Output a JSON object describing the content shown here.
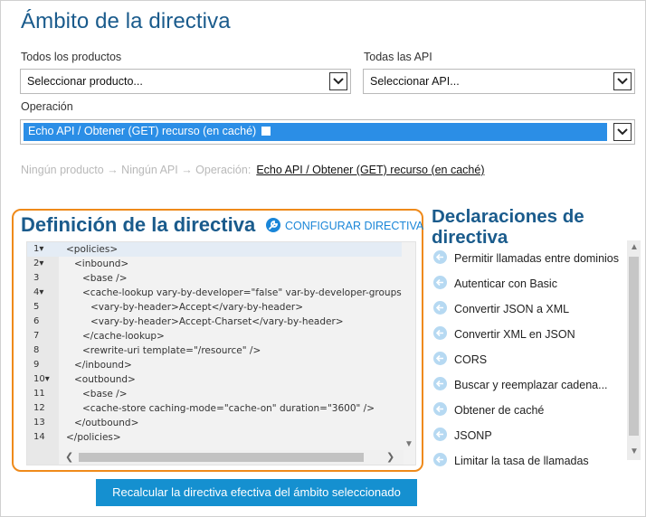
{
  "scope": {
    "title": "Ámbito de la directiva",
    "products_label": "Todos los productos",
    "products_value": "Seleccionar producto...",
    "apis_label": "Todas las API",
    "apis_value": "Seleccionar API...",
    "operation_label": "Operación",
    "operation_value": "Echo API / Obtener (GET) recurso (en caché)"
  },
  "breadcrumb": {
    "muted": "Ningún producto → Ningún API → Operación:",
    "current": "Echo API / Obtener (GET) recurso (en caché)"
  },
  "definition": {
    "title": "Definición de la directiva",
    "configure_label": "CONFIGURAR DIRECTIVA",
    "lines": [
      {
        "n": "1▾",
        "text": "<policies>",
        "indent": 0
      },
      {
        "n": "2▾",
        "text": "<inbound>",
        "indent": 1
      },
      {
        "n": "3",
        "text": "<base />",
        "indent": 2
      },
      {
        "n": "4▾",
        "text": "<cache-lookup vary-by-developer=\"false\" var-by-developer-groups=...",
        "indent": 2
      },
      {
        "n": "5",
        "text": "<vary-by-header>Accept</vary-by-header>",
        "indent": 3
      },
      {
        "n": "6",
        "text": "<vary-by-header>Accept-Charset</vary-by-header>",
        "indent": 3
      },
      {
        "n": "7",
        "text": "</cache-lookup>",
        "indent": 2
      },
      {
        "n": "8",
        "text": "<rewrite-uri template=\"/resource\" />",
        "indent": 2
      },
      {
        "n": "9",
        "text": "</inbound>",
        "indent": 1
      },
      {
        "n": "10▾",
        "text": "<outbound>",
        "indent": 1
      },
      {
        "n": "11",
        "text": "<base />",
        "indent": 2
      },
      {
        "n": "12",
        "text": "<cache-store caching-mode=\"cache-on\" duration=\"3600\" />",
        "indent": 2
      },
      {
        "n": "13",
        "text": "</outbound>",
        "indent": 1
      },
      {
        "n": "14",
        "text": "</policies>",
        "indent": 0
      }
    ]
  },
  "declarations": {
    "title": "Declaraciones de directiva",
    "items": [
      "Permitir llamadas entre dominios",
      "Autenticar con Basic",
      "Convertir JSON a XML",
      "Convertir XML en JSON",
      "CORS",
      "Buscar y reemplazar cadena...",
      "Obtener de caché",
      "JSONP",
      "Limitar la tasa de llamadas"
    ]
  },
  "recalculate_label": "Recalcular la directiva efectiva del ámbito seleccionado",
  "colors": {
    "accent": "#1590d0",
    "title": "#1a5b8c",
    "highlight_border": "#ef8a1a",
    "selection": "#2b8ee6"
  }
}
